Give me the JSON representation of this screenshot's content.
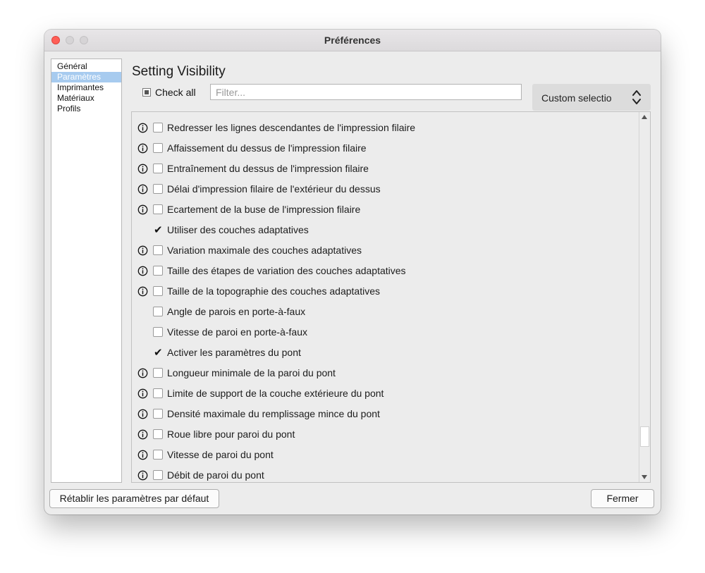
{
  "window": {
    "title": "Préférences"
  },
  "sidebar": {
    "items": [
      {
        "label": "Général",
        "selected": false
      },
      {
        "label": "Paramètres",
        "selected": true
      },
      {
        "label": "Imprimantes",
        "selected": false
      },
      {
        "label": "Matériaux",
        "selected": false
      },
      {
        "label": "Profils",
        "selected": false
      }
    ]
  },
  "main": {
    "heading": "Setting Visibility",
    "check_all_label": "Check all",
    "filter_placeholder": "Filter...",
    "visibility_preset": "Custom selectio"
  },
  "settings": [
    {
      "label": "Redresser les lignes descendantes de l'impression filaire",
      "info": true,
      "checked": false
    },
    {
      "label": "Affaissement du dessus de l'impression filaire",
      "info": true,
      "checked": false
    },
    {
      "label": "Entraînement du dessus de l'impression filaire",
      "info": true,
      "checked": false
    },
    {
      "label": "Délai d'impression filaire de l'extérieur du dessus",
      "info": true,
      "checked": false
    },
    {
      "label": "Ecartement de la buse de l'impression filaire",
      "info": true,
      "checked": false
    },
    {
      "label": "Utiliser des couches adaptatives",
      "info": false,
      "checked": true
    },
    {
      "label": "Variation maximale des couches adaptatives",
      "info": true,
      "checked": false
    },
    {
      "label": "Taille des étapes de variation des couches adaptatives",
      "info": true,
      "checked": false
    },
    {
      "label": "Taille de la topographie des couches adaptatives",
      "info": true,
      "checked": false
    },
    {
      "label": "Angle de parois en porte-à-faux",
      "info": false,
      "checked": false
    },
    {
      "label": "Vitesse de paroi en porte-à-faux",
      "info": false,
      "checked": false
    },
    {
      "label": "Activer les paramètres du pont",
      "info": false,
      "checked": true
    },
    {
      "label": "Longueur minimale de la paroi du pont",
      "info": true,
      "checked": false
    },
    {
      "label": "Limite de support de la couche extérieure du pont",
      "info": true,
      "checked": false
    },
    {
      "label": "Densité maximale du remplissage mince du pont",
      "info": true,
      "checked": false
    },
    {
      "label": "Roue libre pour paroi du pont",
      "info": true,
      "checked": false
    },
    {
      "label": "Vitesse de paroi du pont",
      "info": true,
      "checked": false
    },
    {
      "label": "Débit de paroi du pont",
      "info": true,
      "checked": false
    }
  ],
  "footer": {
    "reset_label": "Rétablir les paramètres par défaut",
    "close_label": "Fermer"
  }
}
